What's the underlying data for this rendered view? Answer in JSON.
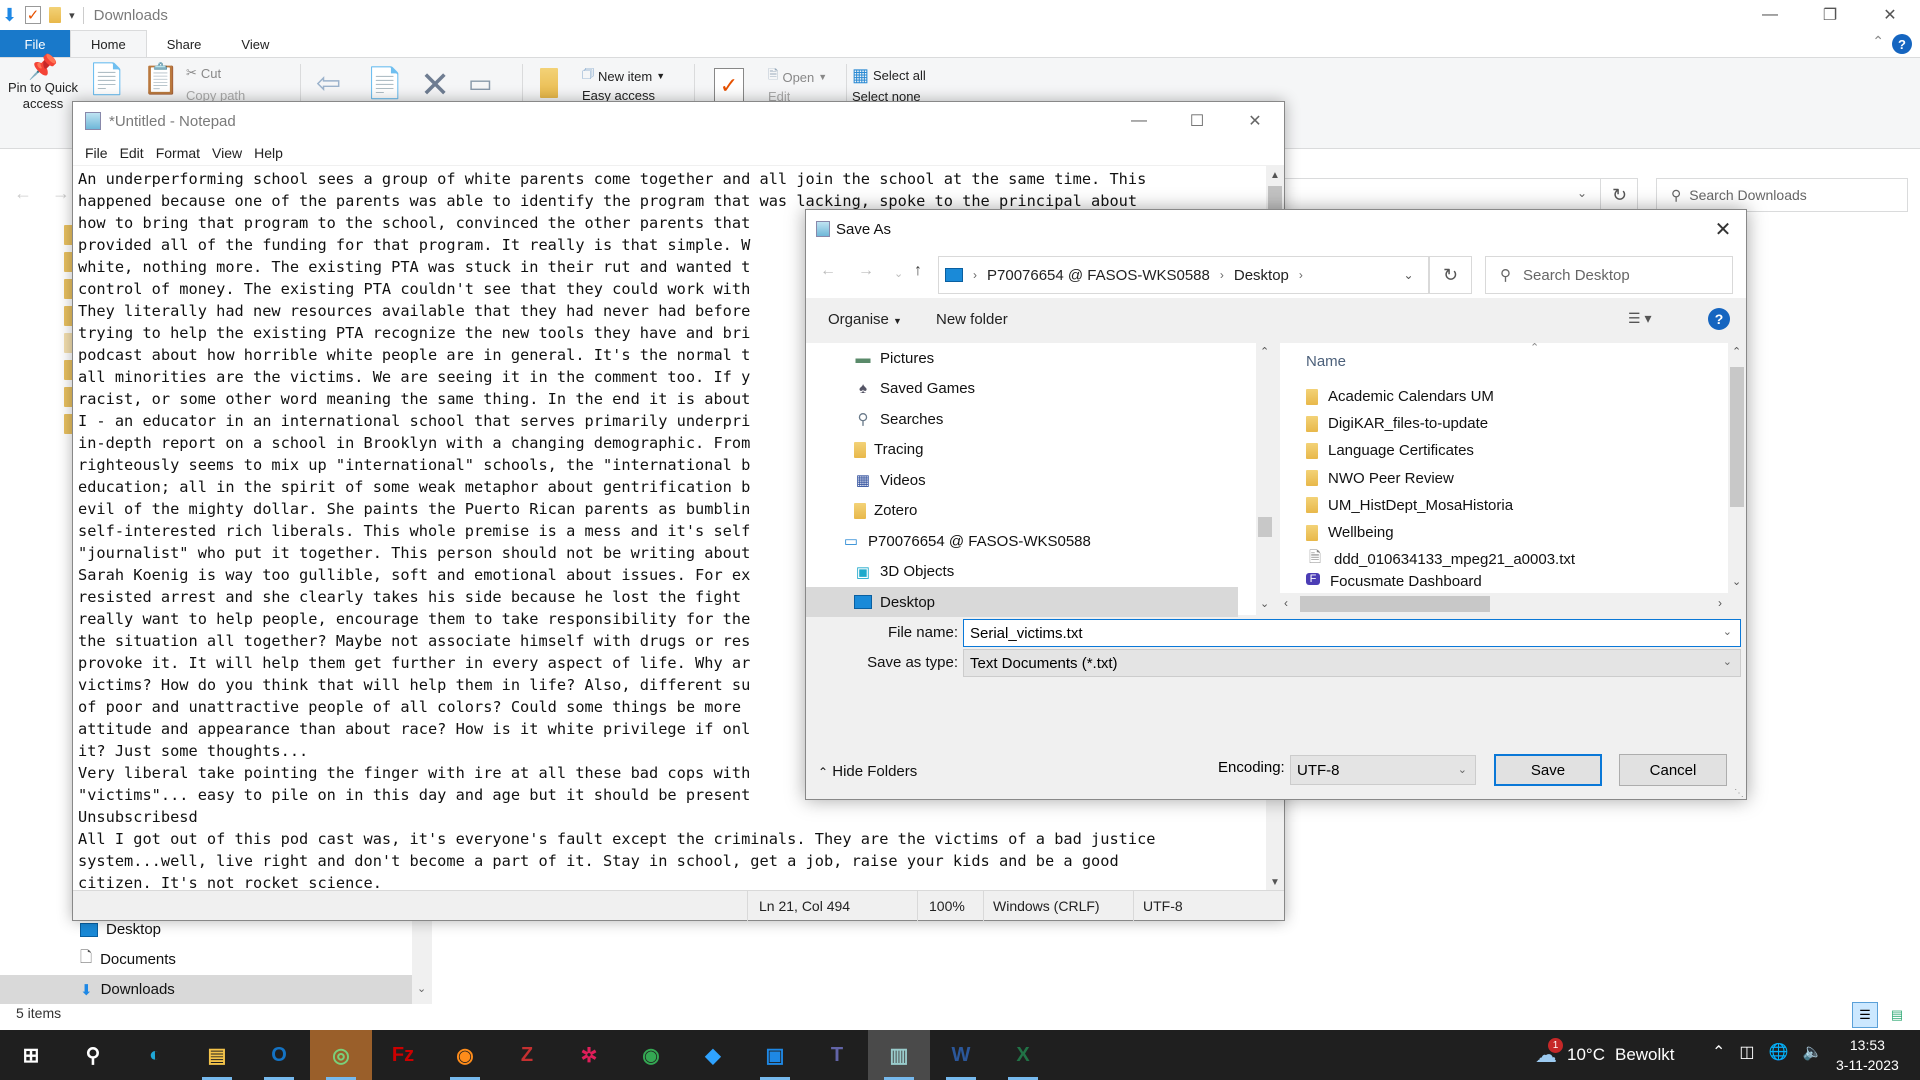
{
  "explorer": {
    "title": "Downloads",
    "tabs": [
      "File",
      "Home",
      "Share",
      "View"
    ],
    "ribbon": {
      "pin": "Pin to Quick access",
      "cut": "Cut",
      "copy_path": "Copy path",
      "new_item": "New item",
      "easy_access": "Easy access",
      "open": "Open",
      "edit": "Edit",
      "select_all": "Select all",
      "select_none": "Select none"
    },
    "search_placeholder": "Search Downloads",
    "sidebar": [
      {
        "label": "Desktop",
        "icon": "desktop-icon"
      },
      {
        "label": "Documents",
        "icon": "documents-icon"
      },
      {
        "label": "Downloads",
        "icon": "downloads-icon",
        "selected": true
      }
    ],
    "status": "5 items"
  },
  "notepad": {
    "title": "*Untitled - Notepad",
    "menu": [
      "File",
      "Edit",
      "Format",
      "View",
      "Help"
    ],
    "lines": [
      "An underperforming school sees a group of white parents come together and all join the school at the same time. This",
      "happened because one of the parents was able to identify the program that was lacking, spoke to the principal about",
      "how to bring that program to the school, convinced the other parents that",
      "provided all of the funding for that program. It really is that simple. W",
      "white, nothing more. The existing PTA was stuck in their rut and wanted t",
      "control of money. The existing PTA couldn't see that they could work with",
      "They literally had new resources available that they had never had before",
      "trying to help the existing PTA recognize the new tools they have and bri",
      "podcast about how horrible white people are in general. It's the normal t",
      "all minorities are the victims. We are seeing it in the comment too. If y",
      "racist, or some other word meaning the same thing. In the end it is about",
      "I - an educator in an international school that serves primarily underpri",
      "in-depth report on a school in Brooklyn with a changing demographic. From",
      "righteously seems to mix up \"international\" schools, the \"international b",
      "education; all in the spirit of some weak metaphor about gentrification b",
      "evil of the mighty dollar. She paints the Puerto Rican parents as bumblin",
      "self-interested rich liberals. This whole premise is a mess and it's self",
      "\"journalist\" who put it together. This person should not be writing about",
      "Sarah Koenig is way too gullible, soft and emotional about issues. For ex",
      "resisted arrest and she clearly takes his side because he lost the fight",
      "really want to help people, encourage them to take responsibility for the",
      "the situation all together? Maybe not associate himself with drugs or res",
      "provoke it. It will help them get further in every aspect of life. Why ar",
      "victims? How do you think that will help them in life? Also, different su",
      "of poor and unattractive people of all colors? Could some things be more",
      "attitude and appearance than about race? How is it white privilege if onl",
      "it? Just some thoughts...",
      "Very liberal take pointing the finger with ire at all these bad cops with",
      "\"victims\"... easy to pile on in this day and age but it should be present",
      "Unsubscribesd",
      "All I got out of this pod cast was, it's everyone's fault except the criminals. They are the victims of a bad justice",
      "system...well, live right and don't become a part of it. Stay in school, get a job, raise your kids and be a good",
      "citizen. It's not rocket science."
    ],
    "status": {
      "position": "Ln 21, Col 494",
      "zoom": "100%",
      "line_ending": "Windows (CRLF)",
      "encoding": "UTF-8"
    }
  },
  "saveas": {
    "title": "Save As",
    "breadcrumb": [
      "P70076654 @ FASOS-WKS0588",
      "Desktop"
    ],
    "search_placeholder": "Search Desktop",
    "organise": "Organise",
    "new_folder": "New folder",
    "tree": [
      {
        "label": "Pictures",
        "icon": "pictures-icon"
      },
      {
        "label": "Saved Games",
        "icon": "saved-games-icon"
      },
      {
        "label": "Searches",
        "icon": "searches-icon"
      },
      {
        "label": "Tracing",
        "icon": "folder-icon"
      },
      {
        "label": "Videos",
        "icon": "videos-icon"
      },
      {
        "label": "Zotero",
        "icon": "folder-icon"
      },
      {
        "label": "P70076654 @ FASOS-WKS0588",
        "icon": "computer-icon"
      },
      {
        "label": "3D Objects",
        "icon": "3d-objects-icon"
      },
      {
        "label": "Desktop",
        "icon": "desktop-icon",
        "selected": true
      }
    ],
    "column_name": "Name",
    "files": [
      {
        "label": "Academic Calendars UM",
        "icon": "folder-icon"
      },
      {
        "label": "DigiKAR_files-to-update",
        "icon": "folder-icon"
      },
      {
        "label": "Language Certificates",
        "icon": "folder-icon"
      },
      {
        "label": "NWO Peer Review",
        "icon": "folder-icon"
      },
      {
        "label": "UM_HistDept_MosaHistoria",
        "icon": "folder-icon"
      },
      {
        "label": "Wellbeing",
        "icon": "folder-icon"
      },
      {
        "label": "ddd_010634133_mpeg21_a0003.txt",
        "icon": "text-file-icon"
      },
      {
        "label": "Focusmate Dashboard",
        "icon": "focusmate-shortcut-icon"
      }
    ],
    "file_name_label": "File name:",
    "file_name_value": "Serial_victims.txt",
    "save_type_label": "Save as type:",
    "save_type_value": "Text Documents (*.txt)",
    "hide_folders": "Hide Folders",
    "encoding_label": "Encoding:",
    "encoding_value": "UTF-8",
    "save": "Save",
    "cancel": "Cancel"
  },
  "taskbar": {
    "apps": [
      "start",
      "search",
      "edge",
      "file-explorer",
      "outlook",
      "app-green-globe",
      "filezilla",
      "firefox",
      "zotero",
      "slack",
      "chrome",
      "app-diamond",
      "app-blue-tile",
      "teams",
      "notepad",
      "word",
      "excel"
    ],
    "weather_temp": "10°C",
    "weather_desc": "Bewolkt",
    "weather_badge": "1",
    "time": "13:53",
    "date": "3-11-2023"
  }
}
